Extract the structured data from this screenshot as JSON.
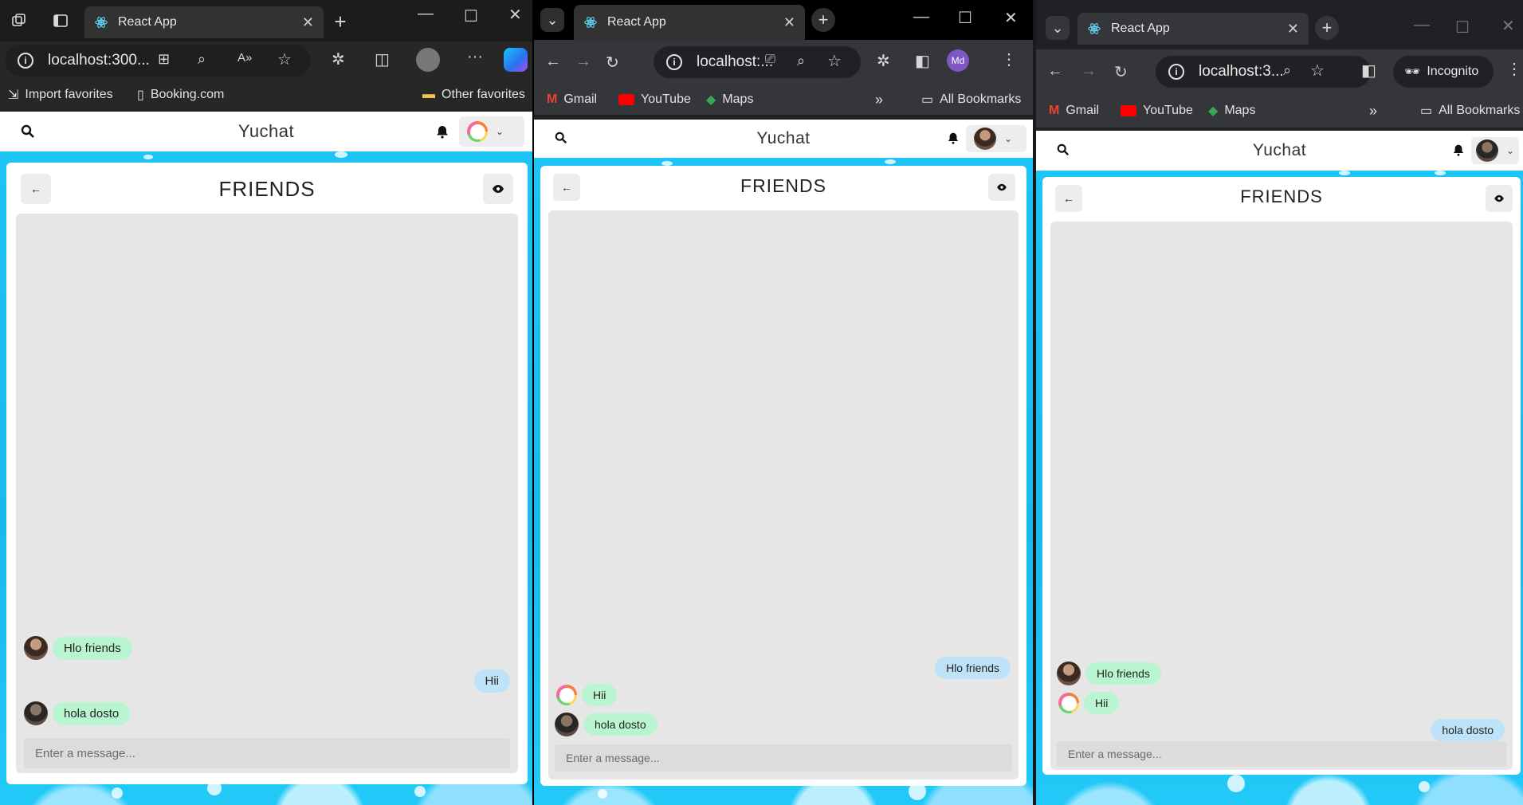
{
  "windows": [
    {
      "id": "edge",
      "tab_title": "React App",
      "address": "localhost:300...",
      "bookmarks": [
        "Import favorites",
        "Booking.com",
        "Other favorites"
      ],
      "app": {
        "brand": "Yuchat",
        "panel_title": "FRIENDS",
        "messages": [
          {
            "side": "in",
            "text": "Hlo friends",
            "avatar": "photo"
          },
          {
            "side": "out",
            "text": "Hii"
          },
          {
            "side": "in",
            "text": "hola dosto",
            "avatar": "photo2"
          }
        ],
        "composer_placeholder": "Enter a message..."
      }
    },
    {
      "id": "chrome",
      "tab_title": "React App",
      "address": "localhost:...",
      "profile_initials": "Md",
      "bookmarks": [
        "Gmail",
        "YouTube",
        "Maps",
        "All Bookmarks"
      ],
      "app": {
        "brand": "Yuchat",
        "panel_title": "FRIENDS",
        "messages": [
          {
            "side": "out",
            "text": "Hlo friends"
          },
          {
            "side": "in",
            "text": "Hii",
            "avatar": "ring"
          },
          {
            "side": "in",
            "text": "hola dosto",
            "avatar": "photo2"
          }
        ],
        "composer_placeholder": "Enter a message..."
      }
    },
    {
      "id": "incognito",
      "tab_title": "React App",
      "address": "localhost:3...",
      "incognito_label": "Incognito",
      "bookmarks": [
        "Gmail",
        "YouTube",
        "Maps",
        "All Bookmarks"
      ],
      "app": {
        "brand": "Yuchat",
        "panel_title": "FRIENDS",
        "messages": [
          {
            "side": "in",
            "text": "Hlo friends",
            "avatar": "photo"
          },
          {
            "side": "in",
            "text": "Hii",
            "avatar": "ring"
          },
          {
            "side": "out",
            "text": "hola dosto"
          }
        ],
        "composer_placeholder": "Enter a message..."
      }
    }
  ],
  "colors": {
    "bubble_in": "#b9f5d0",
    "bubble_out": "#bee3f8",
    "page_bg": "#1ec5f7"
  }
}
